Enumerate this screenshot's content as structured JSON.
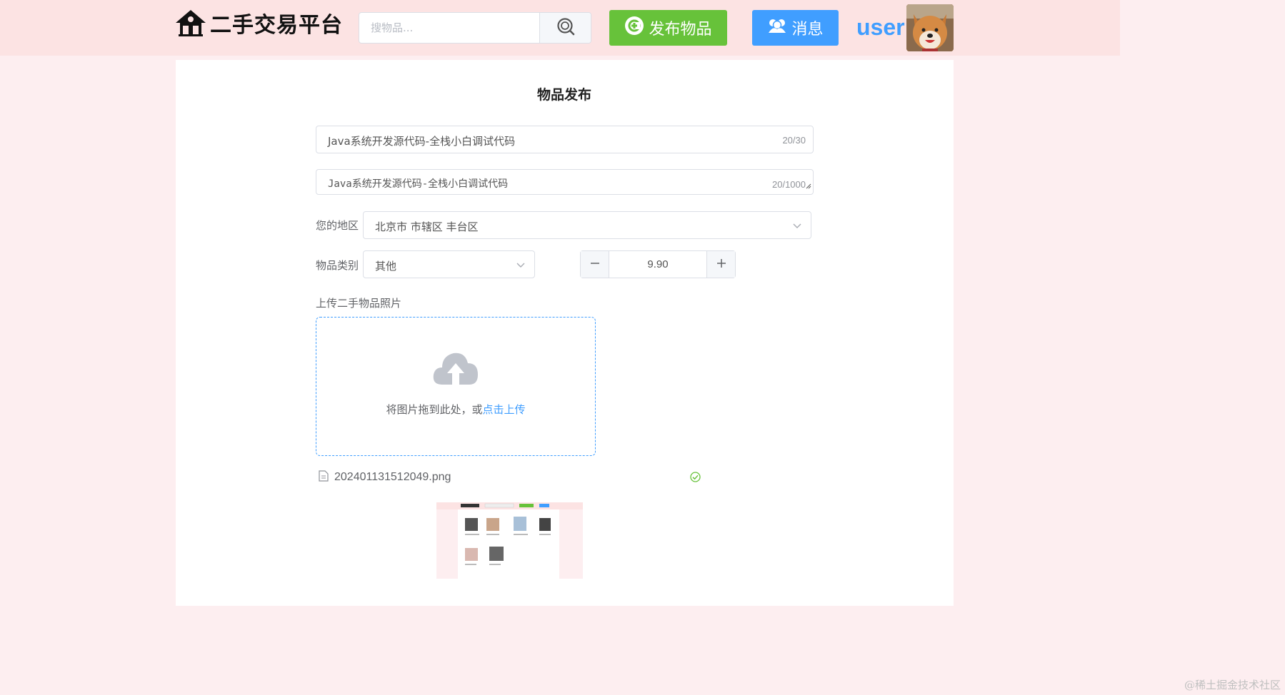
{
  "header": {
    "logo_text": "二手交易平台",
    "search_placeholder": "搜物品...",
    "publish_label": "发布物品",
    "message_label": "消息",
    "username": "user",
    "icons": {
      "logo": "house-icon",
      "search": "search-icon",
      "publish": "plus-circle-icon",
      "message": "users-icon"
    }
  },
  "form": {
    "title": "物品发布",
    "name_value": "Java系统开发源代码-全栈小白调试代码",
    "name_count": "20/30",
    "desc_value": "Java系统开发源代码-全栈小白调试代码",
    "desc_count": "20/1000",
    "region_label": "您的地区",
    "region_value": "北京市 市辖区 丰台区",
    "category_label": "物品类别",
    "category_value": "其他",
    "price_value": "9.90",
    "upload_label": "上传二手物品照片",
    "upload_hint": "将图片拖到此处，或",
    "upload_link": "点击上传",
    "file_name": "202401131512049.png"
  },
  "colors": {
    "header_bg": "#fce3e3",
    "page_bg": "#fdeef0",
    "success": "#67c23a",
    "primary": "#409eff"
  },
  "watermark": "@稀土掘金技术社区"
}
